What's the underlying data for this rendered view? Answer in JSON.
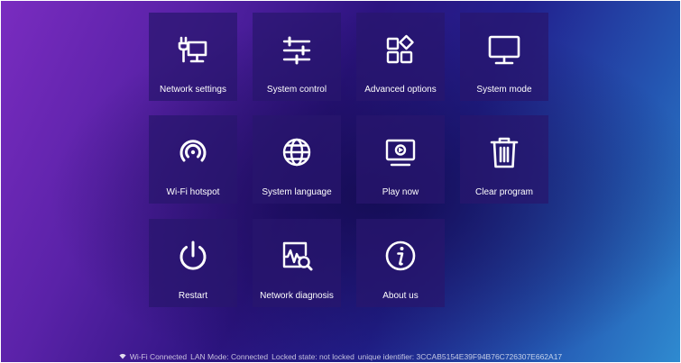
{
  "tiles": [
    {
      "label": "Network settings",
      "icon": "network-settings-icon"
    },
    {
      "label": "System control",
      "icon": "sliders-icon"
    },
    {
      "label": "Advanced options",
      "icon": "grid-diamond-icon"
    },
    {
      "label": "System mode",
      "icon": "monitor-icon"
    },
    {
      "label": "Wi-Fi hotspot",
      "icon": "hotspot-icon"
    },
    {
      "label": "System language",
      "icon": "globe-icon"
    },
    {
      "label": "Play now",
      "icon": "play-screen-icon"
    },
    {
      "label": "Clear program",
      "icon": "trash-icon"
    },
    {
      "label": "Restart",
      "icon": "power-icon"
    },
    {
      "label": "Network diagnosis",
      "icon": "diagnosis-icon"
    },
    {
      "label": "About us",
      "icon": "info-icon"
    }
  ],
  "status": {
    "wifi": "Wi-Fi Connected",
    "lan": "LAN Mode: Connected",
    "locked": "Locked state: not locked",
    "identifier": "unique identifier: 3CCAB5154E39F94B76C726307E662A17"
  }
}
